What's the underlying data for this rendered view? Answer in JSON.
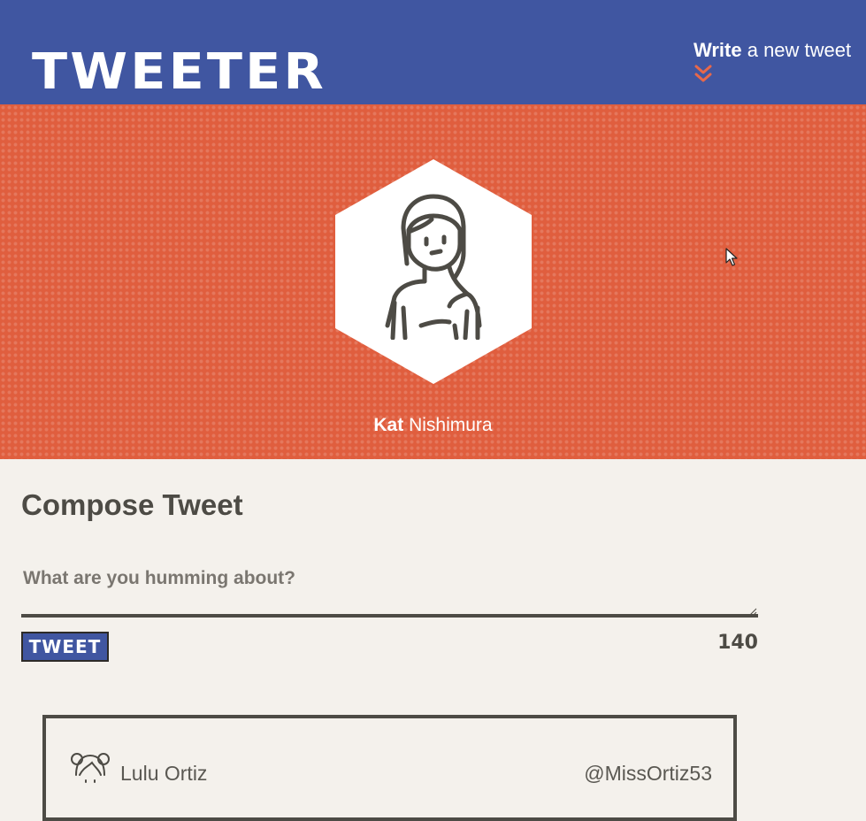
{
  "header": {
    "logo": "TWEETER",
    "compose_toggle": {
      "bold": "Write",
      "rest": " a new tweet"
    }
  },
  "profile": {
    "first_name": "Kat",
    "last_name": " Nishimura"
  },
  "compose": {
    "title": "Compose Tweet",
    "placeholder": "What are you humming about?",
    "button_label": "TWEET",
    "char_counter": "140"
  },
  "tweets": [
    {
      "name": "Lulu Ortiz",
      "handle": "@MissOrtiz53"
    }
  ],
  "colors": {
    "header_bg": "#4056a1",
    "banner_bg": "#e05e3e",
    "page_bg": "#f4f1ec",
    "text_dark": "#4d4b45",
    "accent": "#e8684a"
  },
  "icons": {
    "compose_toggle": "double-chevron-down-icon",
    "profile_avatar": "woman-avatar-icon",
    "tweet_avatar": "girl-avatar-icon"
  }
}
